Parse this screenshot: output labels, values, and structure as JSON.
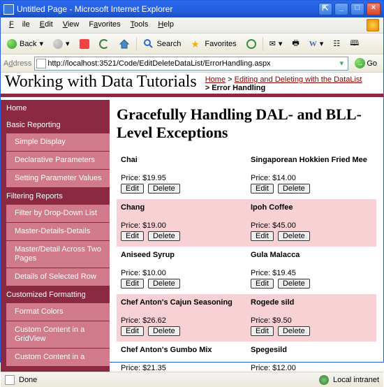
{
  "window": {
    "title": "Untitled Page - Microsoft Internet Explorer"
  },
  "menu": {
    "file": "File",
    "edit": "Edit",
    "view": "View",
    "favorites": "Favorites",
    "tools": "Tools",
    "help": "Help"
  },
  "toolbar": {
    "back": "Back",
    "search": "Search",
    "favorites": "Favorites"
  },
  "address": {
    "label": "Address",
    "url": "http://localhost:3521/Code/EditDeleteDataList/ErrorHandling.aspx",
    "go": "Go"
  },
  "header": {
    "site_title": "Working with Data Tutorials",
    "bc_home": "Home",
    "bc_sep": " > ",
    "bc_section": "Editing and Deleting with the DataList",
    "bc_page": "Error Handling"
  },
  "sidebar": {
    "items": [
      {
        "label": "Home",
        "type": "cat"
      },
      {
        "label": "Basic Reporting",
        "type": "cat"
      },
      {
        "label": "Simple Display",
        "type": "item"
      },
      {
        "label": "Declarative Parameters",
        "type": "item"
      },
      {
        "label": "Setting Parameter Values",
        "type": "item"
      },
      {
        "label": "Filtering Reports",
        "type": "cat"
      },
      {
        "label": "Filter by Drop-Down List",
        "type": "item"
      },
      {
        "label": "Master-Details-Details",
        "type": "item"
      },
      {
        "label": "Master/Detail Across Two Pages",
        "type": "item"
      },
      {
        "label": "Details of Selected Row",
        "type": "item"
      },
      {
        "label": "Customized Formatting",
        "type": "cat"
      },
      {
        "label": "Format Colors",
        "type": "item"
      },
      {
        "label": "Custom Content in a GridView",
        "type": "item"
      },
      {
        "label": "Custom Content in a",
        "type": "item"
      }
    ]
  },
  "content": {
    "heading": "Gracefully Handling DAL- and BLL-Level Exceptions",
    "price_prefix": "Price: ",
    "edit_label": "Edit",
    "delete_label": "Delete",
    "products": [
      {
        "name": "Chai",
        "price": "$19.95",
        "alt": false
      },
      {
        "name": "Singaporean Hokkien Fried Mee",
        "price": "$14.00",
        "alt": false
      },
      {
        "name": "Chang",
        "price": "$19.00",
        "alt": true
      },
      {
        "name": "Ipoh Coffee",
        "price": "$45.00",
        "alt": true
      },
      {
        "name": "Aniseed Syrup",
        "price": "$10.00",
        "alt": false
      },
      {
        "name": "Gula Malacca",
        "price": "$19.45",
        "alt": false
      },
      {
        "name": "Chef Anton's Cajun Seasoning",
        "price": "$26.62",
        "alt": true
      },
      {
        "name": "Rogede sild",
        "price": "$9.50",
        "alt": true
      },
      {
        "name": "Chef Anton's Gumbo Mix",
        "price": "$21.35",
        "alt": false
      },
      {
        "name": "Spegesild",
        "price": "$12.00",
        "alt": false
      }
    ]
  },
  "status": {
    "done": "Done",
    "zone": "Local intranet"
  }
}
